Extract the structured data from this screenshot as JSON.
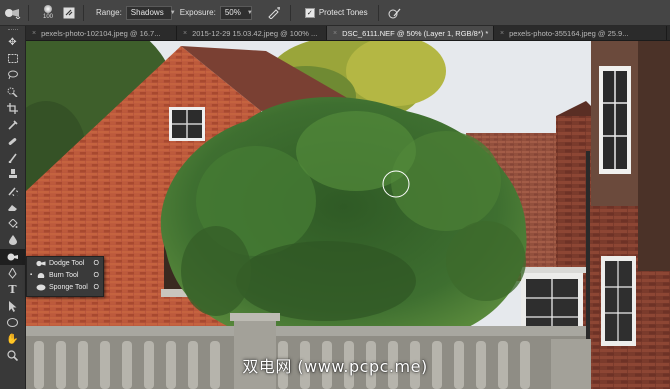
{
  "options_bar": {
    "brush_size": "100",
    "range_label": "Range:",
    "range_value": "Shadows",
    "exposure_label": "Exposure:",
    "exposure_value": "50%",
    "protect_tones_label": "Protect Tones",
    "protect_tones_checked": true
  },
  "tabs": [
    {
      "label": "pexels-photo-102104.jpeg @ 16.7...",
      "active": false
    },
    {
      "label": "2015-12-29 15.03.42.jpeg @ 100% ...",
      "active": false
    },
    {
      "label": "DSC_6111.NEF @ 50% (Layer 1, RGB/8*) *",
      "active": true
    },
    {
      "label": "pexels-photo-355164.jpeg @ 25.9...",
      "active": false
    }
  ],
  "toolbar_tools": [
    "move-tool-icon",
    "marquee-tool-icon",
    "lasso-tool-icon",
    "quick-selection-icon",
    "crop-tool-icon",
    "eyedropper-icon",
    "healing-brush-icon",
    "brush-tool-icon",
    "clone-stamp-icon",
    "history-brush-icon",
    "eraser-icon",
    "paint-bucket-icon",
    "blur-tool-icon",
    "dodge-tool-icon",
    "pen-tool-icon",
    "type-tool-icon",
    "path-selection-icon",
    "shape-tool-icon",
    "hand-tool-icon",
    "zoom-tool-icon"
  ],
  "flyout": [
    {
      "label": "Dodge Tool",
      "shortcut": "O",
      "selected": false
    },
    {
      "label": "Burn Tool",
      "shortcut": "O",
      "selected": true
    },
    {
      "label": "Sponge Tool",
      "shortcut": "O",
      "selected": false
    }
  ],
  "watermark": "双电网 (www.pcpc.me)",
  "colors": {
    "ui_dark": "#393939",
    "options_bar": "#454545",
    "active_tab": "#4a4a4a",
    "sky": "#e6e9ed",
    "brick": "#b5533c",
    "foliage": "#3d6b2e"
  }
}
